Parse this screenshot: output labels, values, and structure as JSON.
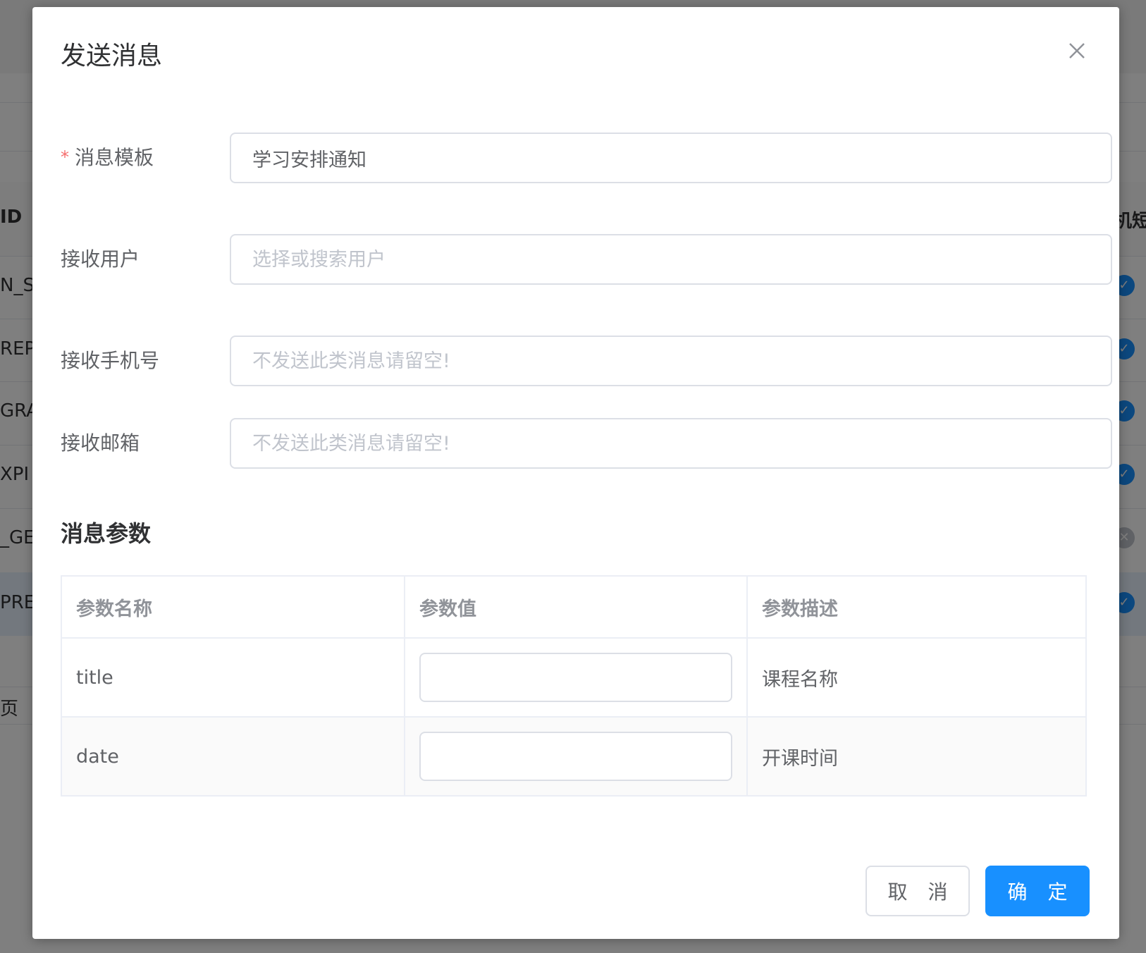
{
  "background": {
    "header_col_left": "ID",
    "header_col_right": "机短",
    "row_fragments": [
      "N_S",
      "REP/",
      "GRA",
      "XPI",
      "_GE",
      "PRE"
    ],
    "pager_fragment": "页",
    "checks": [
      "✓",
      "✓",
      "✓",
      "✓",
      "✕",
      "✓"
    ]
  },
  "dialog": {
    "title": "发送消息",
    "close_icon": "close-icon",
    "form": {
      "template": {
        "required_mark": "*",
        "label": "消息模板",
        "value": "学习安排通知"
      },
      "receive_user": {
        "label": "接收用户",
        "placeholder": "选择或搜索用户"
      },
      "receive_phone": {
        "label": "接收手机号",
        "placeholder": "不发送此类消息请留空!"
      },
      "receive_email": {
        "label": "接收邮箱",
        "placeholder": "不发送此类消息请留空!"
      }
    },
    "params": {
      "section_title": "消息参数",
      "columns": [
        "参数名称",
        "参数值",
        "参数描述"
      ],
      "rows": [
        {
          "name": "title",
          "value": "",
          "desc": "课程名称"
        },
        {
          "name": "date",
          "value": "",
          "desc": "开课时间"
        }
      ]
    },
    "buttons": {
      "cancel": "取 消",
      "confirm": "确 定"
    }
  },
  "colors": {
    "primary": "#1890ff",
    "required": "#f56c6c",
    "border": "#dcdfe6"
  }
}
